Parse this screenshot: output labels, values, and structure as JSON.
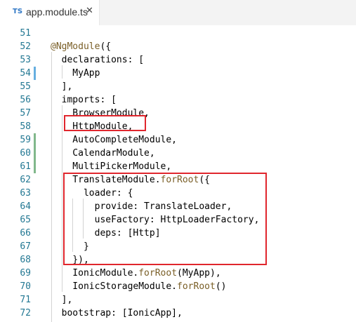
{
  "tab": {
    "badge": "TS",
    "title": "app.module.ts",
    "close_glyph": "✕"
  },
  "colors": {
    "line_number": "#237893",
    "decorator": "#795e26",
    "method": "#795e26",
    "text": "#000000",
    "highlight_box": "#e0262d",
    "git_modified": "#66afe0",
    "git_added": "#81b88b",
    "ts_badge": "#3178c6"
  },
  "editor": {
    "lines": [
      {
        "num": "51",
        "code": [],
        "git": ""
      },
      {
        "num": "52",
        "code": [
          {
            "t": "@NgModule",
            "c": "dec"
          },
          {
            "t": "({"
          }
        ],
        "git": ""
      },
      {
        "num": "53",
        "code": [
          {
            "t": "  declarations: ["
          }
        ],
        "git": ""
      },
      {
        "num": "54",
        "code": [
          {
            "t": "    MyApp"
          }
        ],
        "git": "modified"
      },
      {
        "num": "55",
        "code": [
          {
            "t": "  ],"
          }
        ],
        "git": ""
      },
      {
        "num": "56",
        "code": [
          {
            "t": "  imports: ["
          }
        ],
        "git": ""
      },
      {
        "num": "57",
        "code": [
          {
            "t": "    BrowserModule,"
          }
        ],
        "git": ""
      },
      {
        "num": "58",
        "code": [
          {
            "t": "    HttpModule,"
          }
        ],
        "git": ""
      },
      {
        "num": "59",
        "code": [
          {
            "t": "    AutoCompleteModule,"
          }
        ],
        "git": "added"
      },
      {
        "num": "60",
        "code": [
          {
            "t": "    CalendarModule,"
          }
        ],
        "git": "added"
      },
      {
        "num": "61",
        "code": [
          {
            "t": "    MultiPickerModule,"
          }
        ],
        "git": "added"
      },
      {
        "num": "62",
        "code": [
          {
            "t": "    TranslateModule."
          },
          {
            "t": "forRoot",
            "c": "fn"
          },
          {
            "t": "({"
          }
        ],
        "git": ""
      },
      {
        "num": "63",
        "code": [
          {
            "t": "      loader: {"
          }
        ],
        "git": ""
      },
      {
        "num": "64",
        "code": [
          {
            "t": "        provide: TranslateLoader,"
          }
        ],
        "git": ""
      },
      {
        "num": "65",
        "code": [
          {
            "t": "        useFactory: HttpLoaderFactory,"
          }
        ],
        "git": ""
      },
      {
        "num": "66",
        "code": [
          {
            "t": "        deps: [Http]"
          }
        ],
        "git": ""
      },
      {
        "num": "67",
        "code": [
          {
            "t": "      }"
          }
        ],
        "git": ""
      },
      {
        "num": "68",
        "code": [
          {
            "t": "    }),"
          }
        ],
        "git": ""
      },
      {
        "num": "69",
        "code": [
          {
            "t": "    IonicModule."
          },
          {
            "t": "forRoot",
            "c": "fn"
          },
          {
            "t": "(MyApp),"
          }
        ],
        "git": ""
      },
      {
        "num": "70",
        "code": [
          {
            "t": "    IonicStorageModule."
          },
          {
            "t": "forRoot",
            "c": "fn"
          },
          {
            "t": "()"
          }
        ],
        "git": ""
      },
      {
        "num": "71",
        "code": [
          {
            "t": "  ],"
          }
        ],
        "git": ""
      },
      {
        "num": "72",
        "code": [
          {
            "t": "  bootstrap: [IonicApp],"
          }
        ],
        "git": ""
      }
    ]
  }
}
